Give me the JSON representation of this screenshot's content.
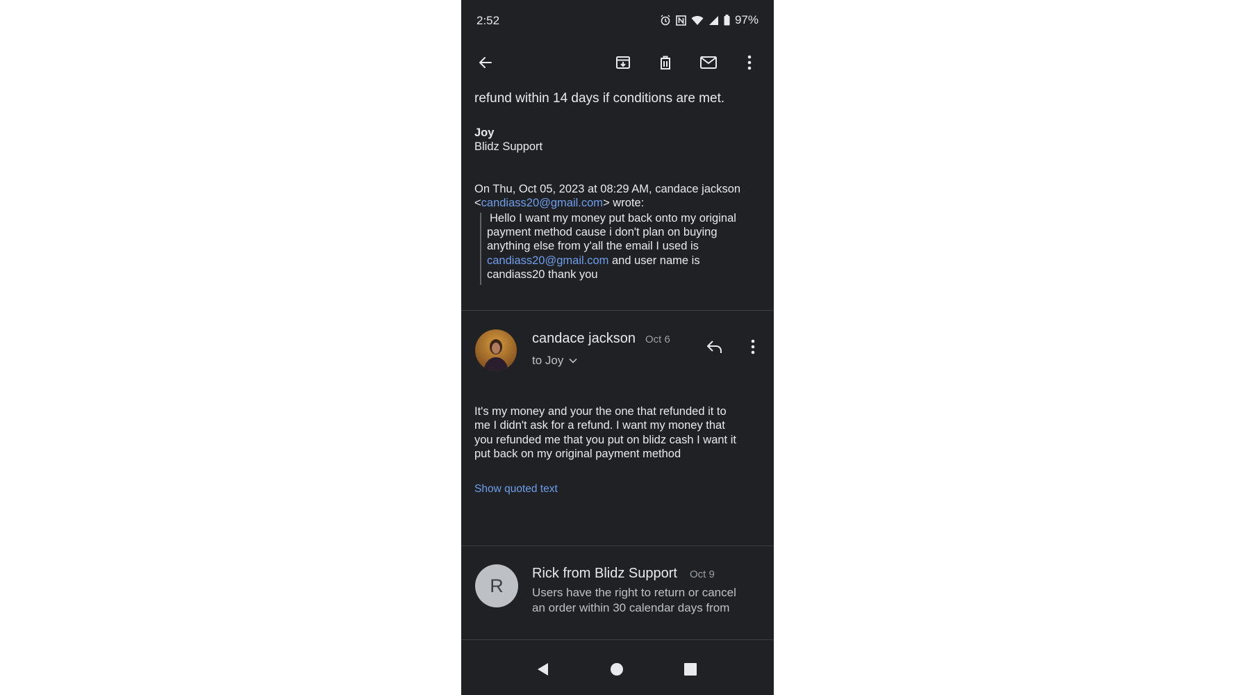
{
  "status_bar": {
    "time": "2:52",
    "battery": "97%"
  },
  "toolbar": {
    "back": "back-arrow-icon",
    "archive": "archive-icon",
    "delete": "trash-icon",
    "mark_unread": "mail-icon",
    "more": "more-vert-icon"
  },
  "message1": {
    "body_end": "refund within 14 days if conditions are met.",
    "signature_name": "Joy",
    "signature_team": "Blidz Support",
    "quote_header_prefix": "On Thu, Oct 05, 2023 at 08:29 AM, candace jackson",
    "quote_header_email": "candiass20@gmail.com",
    "quote_header_suffix": "> wrote:",
    "quote_line1": "Hello I want my money put back onto my original",
    "quote_line2": "payment method cause i don't plan on buying",
    "quote_line3": "anything else from y'all  the email I used is",
    "quote_email": "candiass20@gmail.com",
    "quote_line4_suffix": " and user name is",
    "quote_line5": "candiass20 thank you"
  },
  "message2": {
    "sender": "candace jackson",
    "date": "Oct 6",
    "recipient": "to Joy",
    "body_line1": "It's my money and your the one that refunded it to",
    "body_line2": "me I didn't ask for a refund. I want my money that",
    "body_line3": "you refunded me that you put on blidz cash I want it",
    "body_line4": "put back on my original payment method",
    "show_quoted": "Show quoted text"
  },
  "message3": {
    "avatar_letter": "R",
    "sender": "Rick from Blidz Support",
    "date": "Oct 9",
    "snippet_line1": "Users have the right to return or cancel",
    "snippet_line2": "an order within 30 calendar days from"
  },
  "colors": {
    "background": "#202124",
    "link": "#6d9eeb",
    "avatar_r": "#bdc1c6"
  }
}
